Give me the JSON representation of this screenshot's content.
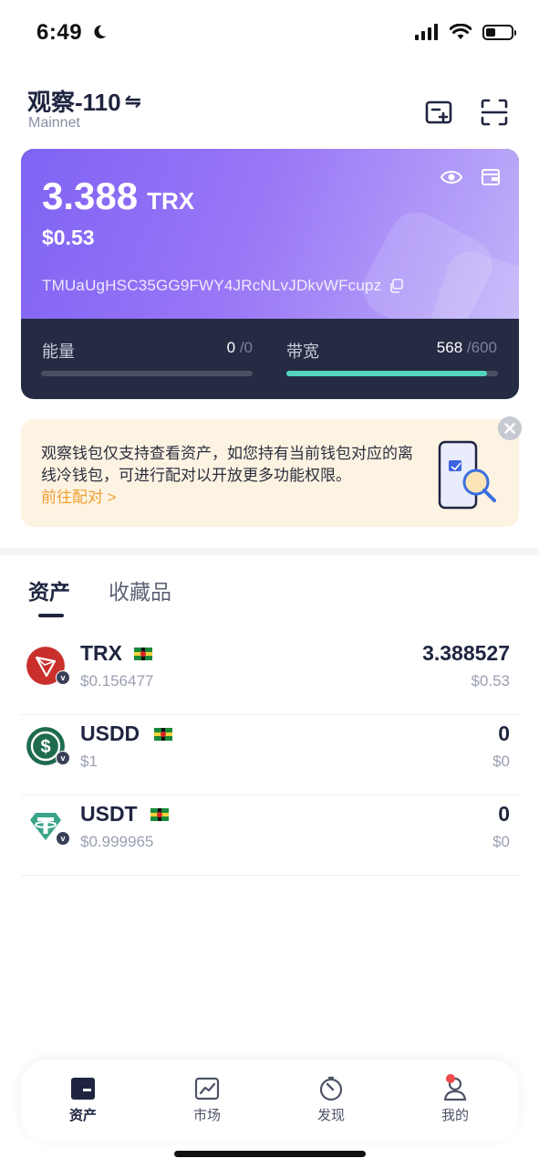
{
  "status_bar": {
    "time": "6:49"
  },
  "header": {
    "wallet_name": "观察-110",
    "swap_symbol": "⇋",
    "network": "Mainnet"
  },
  "balance_card": {
    "amount": "3.388",
    "unit": "TRX",
    "usd": "$0.53",
    "address": "TMUaUgHSC35GG9FWY4JRcNLvJDkvWFcupz",
    "resources": {
      "energy": {
        "label": "能量",
        "used": "0",
        "max": "/0",
        "fraction": 0
      },
      "bandwidth": {
        "label": "带宽",
        "used": "568",
        "max": "/600",
        "fraction": 0.947
      }
    }
  },
  "banner": {
    "text": "观察钱包仅支持查看资产，如您持有当前钱包对应的离线冷钱包，可进行配对以开放更多功能权限。",
    "link": "前往配对 >"
  },
  "tabs": [
    {
      "label": "资产"
    },
    {
      "label": "收藏品"
    }
  ],
  "assets": [
    {
      "symbol": "TRX",
      "price": "$0.156477",
      "quantity": "3.388527",
      "value": "$0.53"
    },
    {
      "symbol": "USDD",
      "price": "$1",
      "quantity": "0",
      "value": "$0"
    },
    {
      "symbol": "USDT",
      "price": "$0.999965",
      "quantity": "0",
      "value": "$0"
    }
  ],
  "bottom_nav": [
    {
      "label": "资产",
      "icon": "wallet-icon"
    },
    {
      "label": "市场",
      "icon": "chart-icon"
    },
    {
      "label": "发现",
      "icon": "compass-icon"
    },
    {
      "label": "我的",
      "icon": "user-icon"
    }
  ],
  "colors": {
    "card_gradient_start": "#7f63f4",
    "card_dark": "#262b44",
    "bandwidth_bar": "#52d6c0",
    "banner_bg": "#fdf3e2",
    "link_orange": "#f0a033",
    "trx_red": "#c9302c",
    "usdd_green": "#1f6b4e",
    "usdt_teal": "#3aa58a"
  }
}
